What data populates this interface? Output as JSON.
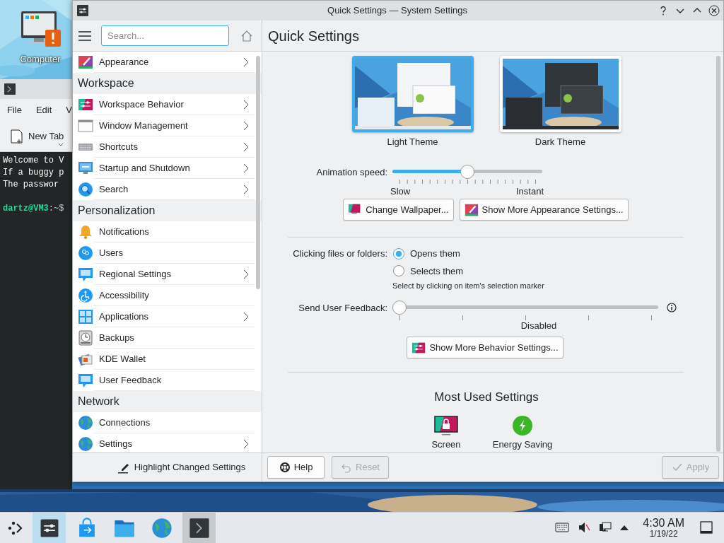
{
  "desktop_icons": [
    {
      "label": "Computer"
    }
  ],
  "terminal": {
    "menu": [
      "File",
      "Edit",
      "V"
    ],
    "toolbar_button": "New Tab",
    "lines": [
      "Welcome to V",
      "If a buggy p",
      "The passwor"
    ],
    "prompt": {
      "user_host": "dartz@VM3",
      "path": ":~$"
    }
  },
  "window": {
    "title": "Quick Settings — System Settings"
  },
  "sidebar": {
    "search": {
      "placeholder": "Search..."
    },
    "items": [
      {
        "kind": "item",
        "label": "Appearance",
        "has_submenu": true
      },
      {
        "kind": "header",
        "label": "Workspace"
      },
      {
        "kind": "item",
        "label": "Workspace Behavior",
        "has_submenu": true
      },
      {
        "kind": "item",
        "label": "Window Management",
        "has_submenu": true
      },
      {
        "kind": "item",
        "label": "Shortcuts",
        "has_submenu": true
      },
      {
        "kind": "item",
        "label": "Startup and Shutdown",
        "has_submenu": true
      },
      {
        "kind": "item",
        "label": "Search",
        "has_submenu": true
      },
      {
        "kind": "header",
        "label": "Personalization"
      },
      {
        "kind": "item",
        "label": "Notifications",
        "has_submenu": false
      },
      {
        "kind": "item",
        "label": "Users",
        "has_submenu": false
      },
      {
        "kind": "item",
        "label": "Regional Settings",
        "has_submenu": true
      },
      {
        "kind": "item",
        "label": "Accessibility",
        "has_submenu": false
      },
      {
        "kind": "item",
        "label": "Applications",
        "has_submenu": true
      },
      {
        "kind": "item",
        "label": "Backups",
        "has_submenu": false
      },
      {
        "kind": "item",
        "label": "KDE Wallet",
        "has_submenu": false
      },
      {
        "kind": "item",
        "label": "User Feedback",
        "has_submenu": false
      },
      {
        "kind": "header",
        "label": "Network"
      },
      {
        "kind": "item",
        "label": "Connections",
        "has_submenu": false
      },
      {
        "kind": "item",
        "label": "Settings",
        "has_submenu": true
      }
    ],
    "footer_button": "Highlight Changed Settings"
  },
  "page": {
    "title": "Quick Settings",
    "themes": [
      {
        "label": "Light Theme",
        "kind": "light",
        "selected": true
      },
      {
        "label": "Dark Theme",
        "kind": "dark",
        "selected": false
      }
    ],
    "animation_speed": {
      "label": "Animation speed:",
      "level": 0.5,
      "min_label": "Slow",
      "max_label": "Instant"
    },
    "appearance_buttons": [
      "Change Wallpaper...",
      "Show More Appearance Settings..."
    ],
    "clicking": {
      "label": "Clicking files or folders:",
      "options": [
        {
          "label": "Opens them",
          "selected": true
        },
        {
          "label": "Selects them",
          "selected": false
        }
      ],
      "hint": "Select by clicking on item's selection marker"
    },
    "feedback": {
      "label": "Send User Feedback:",
      "level": 0,
      "value_label": "Disabled"
    },
    "behavior_button": "Show More Behavior Settings...",
    "most_used": {
      "title": "Most Used Settings",
      "items": [
        {
          "label": "Screen"
        },
        {
          "label": "Energy Saving"
        }
      ]
    }
  },
  "footer": {
    "buttons": [
      {
        "label": "Help",
        "disabled": false
      },
      {
        "label": "Reset",
        "disabled": true
      },
      {
        "label": "Apply",
        "disabled": true
      }
    ]
  },
  "taskbar": {
    "tasks": [
      {
        "selected": true,
        "running": true
      },
      {
        "selected": false,
        "running": false
      },
      {
        "selected": false,
        "running": false
      },
      {
        "selected": false,
        "running": false
      },
      {
        "selected": false,
        "running": true
      }
    ]
  },
  "clock": {
    "time": "4:30 AM",
    "date": "1/19/22"
  }
}
